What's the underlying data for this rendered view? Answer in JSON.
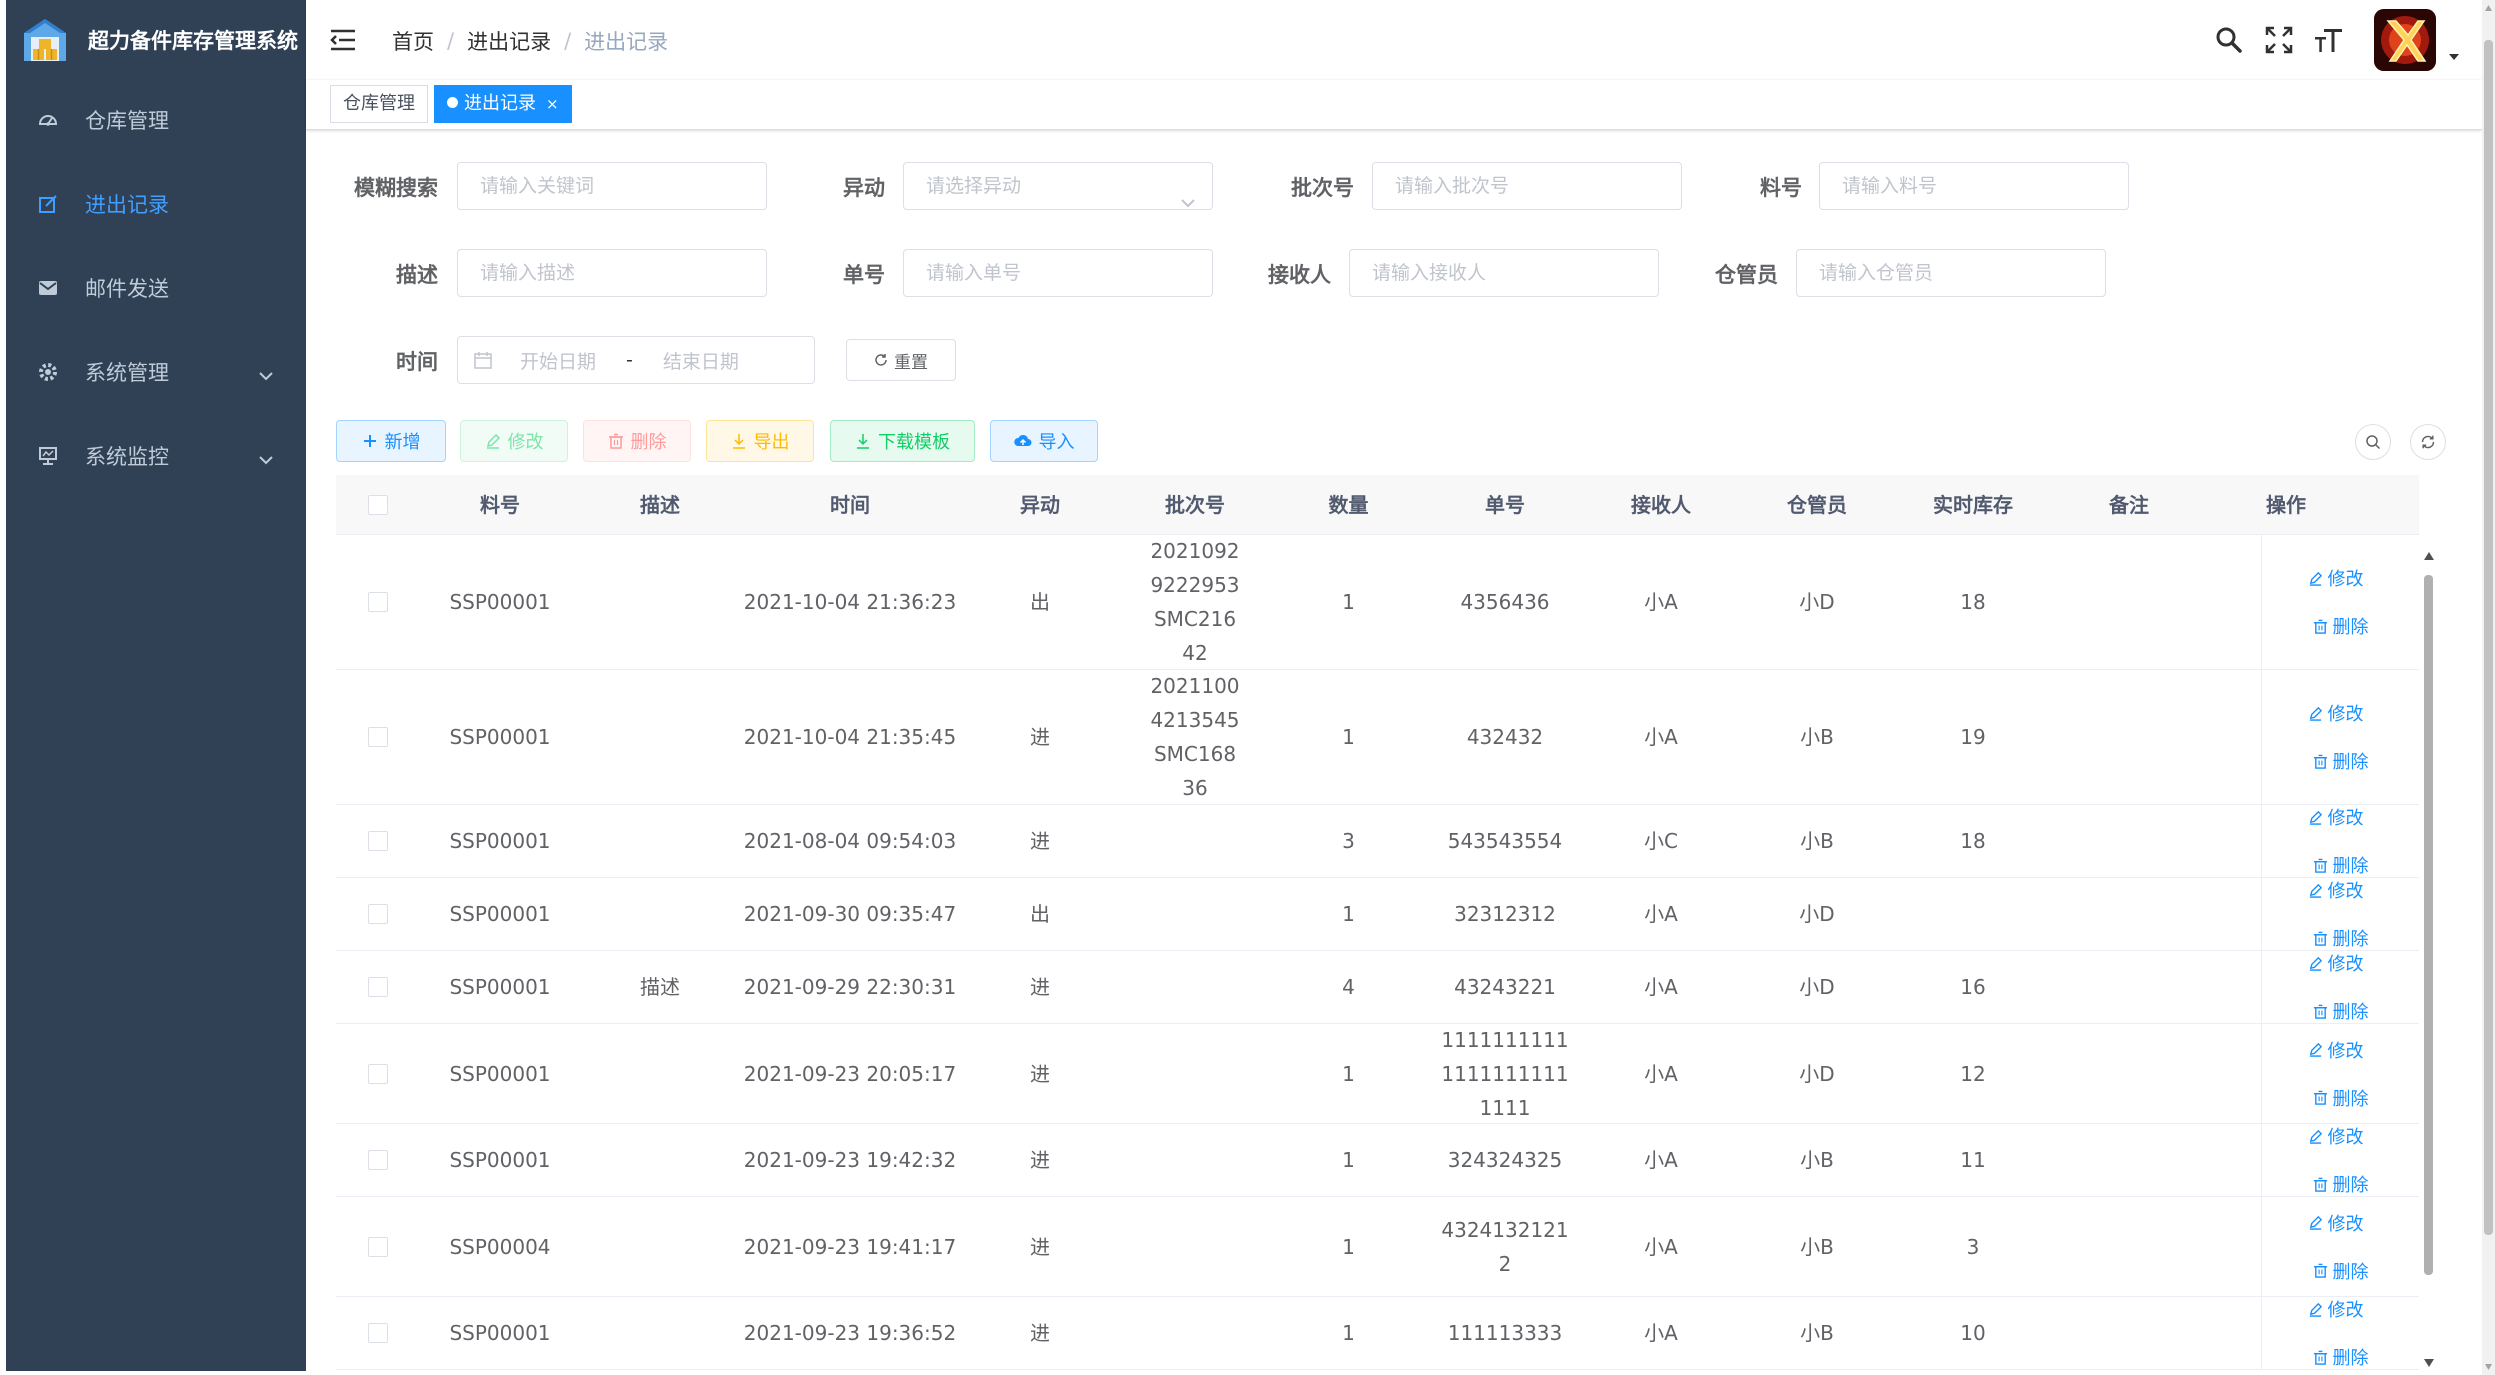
{
  "app": {
    "title": "超力备件库存管理系统"
  },
  "colors": {
    "sidebar_bg": "#304156",
    "accent": "#1890ff",
    "menu_text": "#bfcbd9"
  },
  "sidebar": {
    "items": [
      {
        "label": "仓库管理",
        "icon": "dashboard-icon",
        "active": false
      },
      {
        "label": "进出记录",
        "icon": "edit-icon",
        "active": true
      },
      {
        "label": "邮件发送",
        "icon": "mail-icon",
        "active": false
      },
      {
        "label": "系统管理",
        "icon": "gear-icon",
        "active": false,
        "expandable": true
      },
      {
        "label": "系统监控",
        "icon": "monitor-icon",
        "active": false,
        "expandable": true
      }
    ]
  },
  "navbar": {
    "breadcrumb": [
      "首页",
      "进出记录",
      "进出记录"
    ],
    "separator": "/",
    "tools": [
      "search-icon",
      "fullscreen-icon",
      "font-size-icon"
    ]
  },
  "tags": [
    {
      "label": "仓库管理",
      "active": false
    },
    {
      "label": "进出记录",
      "active": true,
      "close": "×"
    }
  ],
  "search": {
    "keyword": {
      "label": "模糊搜索",
      "placeholder": "请输入关键词"
    },
    "change": {
      "label": "异动",
      "placeholder": "请选择异动"
    },
    "batch": {
      "label": "批次号",
      "placeholder": "请输入批次号"
    },
    "material": {
      "label": "料号",
      "placeholder": "请输入料号"
    },
    "desc": {
      "label": "描述",
      "placeholder": "请输入描述"
    },
    "order": {
      "label": "单号",
      "placeholder": "请输入单号"
    },
    "receiver": {
      "label": "接收人",
      "placeholder": "请输入接收人"
    },
    "keeper": {
      "label": "仓管员",
      "placeholder": "请输入仓管员"
    },
    "time": {
      "label": "时间",
      "start": "开始日期",
      "sep": "-",
      "end": "结束日期"
    },
    "reset": "重置"
  },
  "toolbar": {
    "add": "新增",
    "edit": "修改",
    "delete": "删除",
    "export": "导出",
    "template": "下载模板",
    "import": "导入"
  },
  "table": {
    "columns": [
      "料号",
      "描述",
      "时间",
      "异动",
      "批次号",
      "数量",
      "单号",
      "接收人",
      "仓管员",
      "实时库存",
      "备注",
      "操作"
    ],
    "op_edit": "修改",
    "op_delete": "删除",
    "rows": [
      {
        "material": "SSP00001",
        "desc": "",
        "time": "2021-10-04 21:36:23",
        "change": "出",
        "batch": "20210929222953SMC21642",
        "qty": "1",
        "order": "4356436",
        "receiver": "小A",
        "keeper": "小D",
        "stock": "18",
        "remark": ""
      },
      {
        "material": "SSP00001",
        "desc": "",
        "time": "2021-10-04 21:35:45",
        "change": "进",
        "batch": "20211004213545SMC16836",
        "qty": "1",
        "order": "432432",
        "receiver": "小A",
        "keeper": "小B",
        "stock": "19",
        "remark": ""
      },
      {
        "material": "SSP00001",
        "desc": "",
        "time": "2021-08-04 09:54:03",
        "change": "进",
        "batch": "",
        "qty": "3",
        "order": "543543554",
        "receiver": "小C",
        "keeper": "小B",
        "stock": "18",
        "remark": ""
      },
      {
        "material": "SSP00001",
        "desc": "",
        "time": "2021-09-30 09:35:47",
        "change": "出",
        "batch": "",
        "qty": "1",
        "order": "32312312",
        "receiver": "小A",
        "keeper": "小D",
        "stock": "",
        "remark": ""
      },
      {
        "material": "SSP00001",
        "desc": "描述",
        "time": "2021-09-29 22:30:31",
        "change": "进",
        "batch": "",
        "qty": "4",
        "order": "43243221",
        "receiver": "小A",
        "keeper": "小D",
        "stock": "16",
        "remark": ""
      },
      {
        "material": "SSP00001",
        "desc": "",
        "time": "2021-09-23 20:05:17",
        "change": "进",
        "batch": "",
        "qty": "1",
        "order": "111111111111111111111111",
        "receiver": "小A",
        "keeper": "小D",
        "stock": "12",
        "remark": ""
      },
      {
        "material": "SSP00001",
        "desc": "",
        "time": "2021-09-23 19:42:32",
        "change": "进",
        "batch": "",
        "qty": "1",
        "order": "324324325",
        "receiver": "小A",
        "keeper": "小B",
        "stock": "11",
        "remark": ""
      },
      {
        "material": "SSP00004",
        "desc": "",
        "time": "2021-09-23 19:41:17",
        "change": "进",
        "batch": "",
        "qty": "1",
        "order": "43241321212",
        "receiver": "小A",
        "keeper": "小B",
        "stock": "3",
        "remark": ""
      },
      {
        "material": "SSP00001",
        "desc": "",
        "time": "2021-09-23 19:36:52",
        "change": "进",
        "batch": "",
        "qty": "1",
        "order": "111113333",
        "receiver": "小A",
        "keeper": "小B",
        "stock": "10",
        "remark": ""
      }
    ]
  }
}
